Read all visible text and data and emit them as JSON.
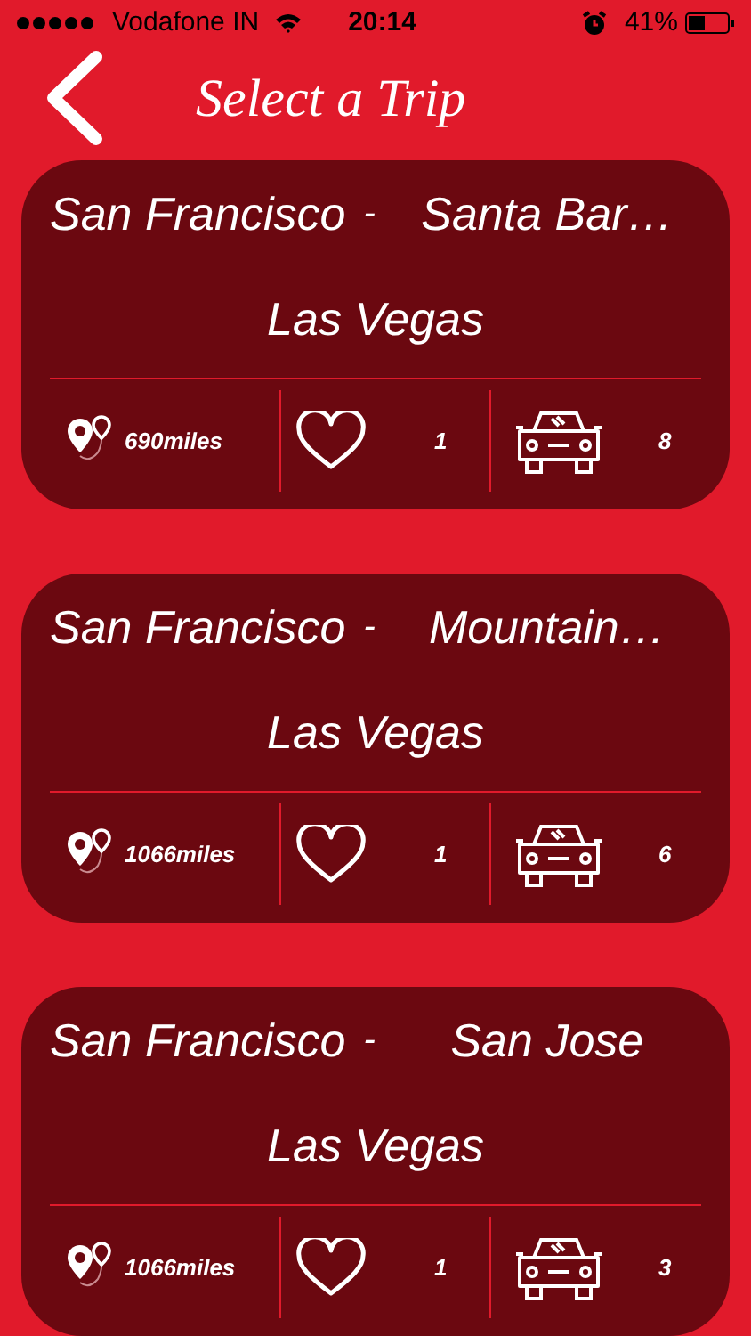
{
  "status_bar": {
    "carrier": "Vodafone IN",
    "time": "20:14",
    "battery": "41%"
  },
  "header": {
    "title": "Select a Trip"
  },
  "trips": [
    {
      "origin": "San Francisco",
      "separator": "-",
      "via": "Santa Bar…",
      "destination": "Las Vegas",
      "distance": "690miles",
      "likes": "1",
      "cars": "8"
    },
    {
      "origin": "San Francisco",
      "separator": "-",
      "via": "Mountain…",
      "destination": "Las Vegas",
      "distance": "1066miles",
      "likes": "1",
      "cars": "6"
    },
    {
      "origin": "San Francisco",
      "separator": "-",
      "via": "San Jose",
      "destination": "Las Vegas",
      "distance": "1066miles",
      "likes": "1",
      "cars": "3"
    }
  ]
}
